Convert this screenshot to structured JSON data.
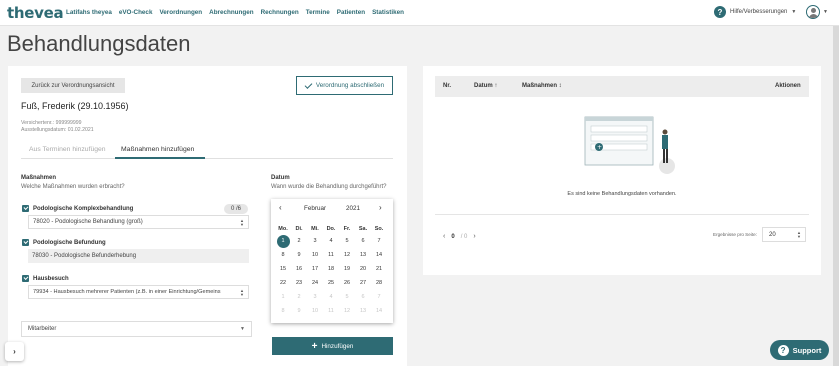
{
  "app": {
    "logo": "thevea"
  },
  "nav": {
    "items": [
      "Latifahs theyea",
      "eVO-Check",
      "Verordnungen",
      "Abrechnungen",
      "Rechnungen",
      "Termine",
      "Patienten",
      "Statistiken"
    ]
  },
  "header": {
    "help_label": "Hilfe/Verbesserungen"
  },
  "page": {
    "title": "Behandlungsdaten"
  },
  "left": {
    "back_button": "Zurück zur Verordnungsansicht",
    "close_button": "Verordnung abschließen",
    "patient_name": "Fuß, Frederik (29.10.1956)",
    "insurance_no": "Versichertenr.: 999999999",
    "issue_date": "Ausstellungsdatum: 01.02.2021",
    "tabs": [
      "Aus Terminen hinzufügen",
      "Maßnahmen hinzufügen"
    ],
    "measures_title": "Maßnahmen",
    "measures_question": "Welche Maßnahmen wurden erbracht?",
    "date_title": "Datum",
    "date_question": "Wann wurde die Behandlung durchgeführt?",
    "counter": "0 /6",
    "measures": [
      {
        "label": "Podologische Komplexbehandlung",
        "value": "78020 - Podologische Behandlung (groß)"
      },
      {
        "label": "Podologische Befundung",
        "value": "78030 - Podologische Befunderhebung"
      },
      {
        "label": "Hausbesuch",
        "value": "79934 - Hausbesuch mehrerer Patienten (z.B. in einer Einrichtung/Gemeins"
      }
    ],
    "employee_placeholder": "Mitarbeiter",
    "add_button": "Hinzufügen"
  },
  "calendar": {
    "month": "Februar",
    "year": "2021",
    "weekdays": [
      "Mo.",
      "Di.",
      "Mi.",
      "Do.",
      "Fr.",
      "Sa.",
      "So."
    ],
    "rows": [
      [
        "1",
        "2",
        "3",
        "4",
        "5",
        "6",
        "7"
      ],
      [
        "8",
        "9",
        "10",
        "11",
        "12",
        "13",
        "14"
      ],
      [
        "15",
        "16",
        "17",
        "18",
        "19",
        "20",
        "21"
      ],
      [
        "22",
        "23",
        "24",
        "25",
        "26",
        "27",
        "28"
      ],
      [
        "1",
        "2",
        "3",
        "4",
        "5",
        "6",
        "7"
      ],
      [
        "8",
        "9",
        "10",
        "11",
        "12",
        "13",
        "14"
      ]
    ],
    "selected": "1"
  },
  "right": {
    "headers": {
      "nr": "Nr.",
      "datum": "Datum ↑",
      "massnahmen": "Maßnahmen ↕",
      "aktionen": "Aktionen"
    },
    "empty_message": "Es sind keine Behandlungsdaten vorhanden.",
    "pager_current": "0",
    "pager_total": "/ 0",
    "per_page_label": "Ergebnisse pro Seite:",
    "per_page_value": "20"
  },
  "footer": {
    "support_label": "Support"
  },
  "colors": {
    "accent": "#2e6b74"
  }
}
